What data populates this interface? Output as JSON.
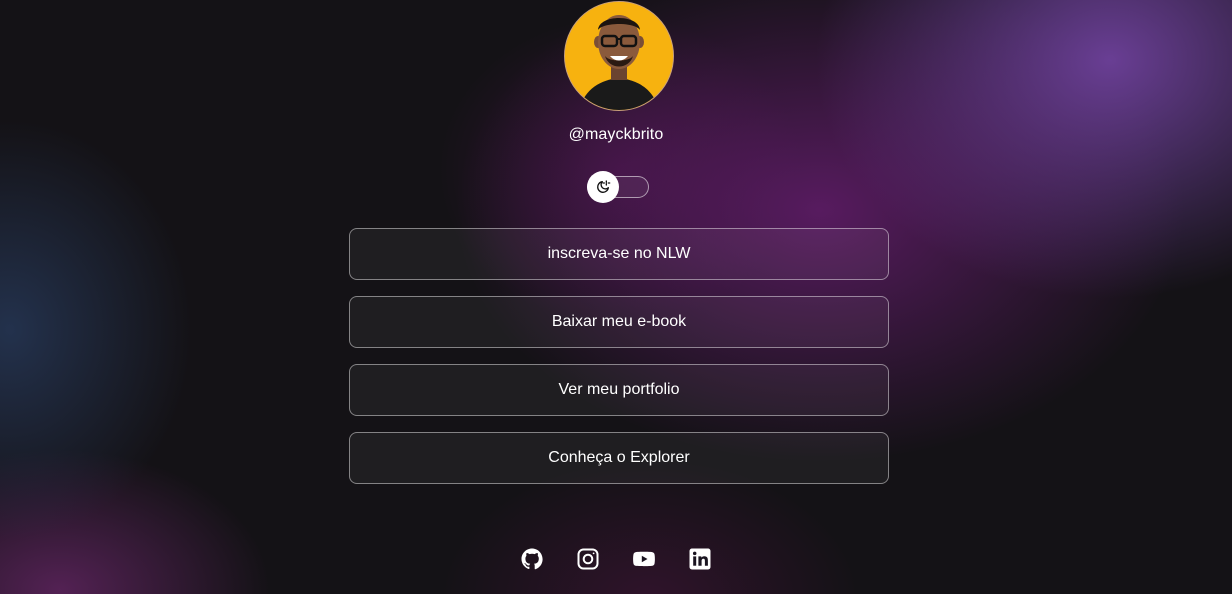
{
  "profile": {
    "avatar_alt": "Foto do Mayk Brito",
    "username": "@mayckbrito",
    "avatar_bg": "#f7b20f"
  },
  "theme_switch": {
    "icon": "moon-sun-icon"
  },
  "links": [
    {
      "label": "inscreva-se no NLW"
    },
    {
      "label": "Baixar meu e-book"
    },
    {
      "label": "Ver meu portfolio"
    },
    {
      "label": "Conheça o Explorer"
    }
  ],
  "socials": [
    {
      "icon": "github-icon"
    },
    {
      "icon": "instagram-icon"
    },
    {
      "icon": "youtube-icon"
    },
    {
      "icon": "linkedin-icon"
    }
  ],
  "colors": {
    "text": "#ffffff",
    "accent_purple": "#7846aa",
    "background": "#141216"
  }
}
